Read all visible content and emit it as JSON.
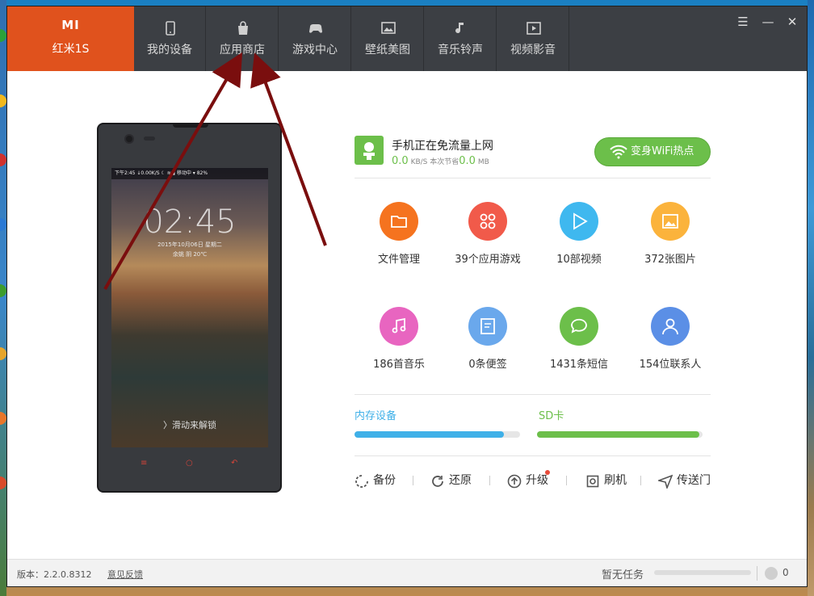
{
  "app": {
    "brand": "MI",
    "model": "红米1S"
  },
  "tabs": [
    {
      "label": "我的设备",
      "icon": "phone-icon"
    },
    {
      "label": "应用商店",
      "icon": "bag-icon"
    },
    {
      "label": "游戏中心",
      "icon": "gamepad-icon"
    },
    {
      "label": "壁纸美图",
      "icon": "picture-icon"
    },
    {
      "label": "音乐铃声",
      "icon": "music-note-icon"
    },
    {
      "label": "视频影音",
      "icon": "video-play-icon"
    }
  ],
  "window_controls": {
    "menu": "☰",
    "minimize": "—",
    "close": "✕"
  },
  "phone_screen": {
    "status_text": "下午2:45 ↓0.00K/S  ☾  ≋ ▮ 移动中 ▾ 82%",
    "clock": "02:45",
    "date": "2015年10月06日 星期二",
    "weather": "余姚 阴 20℃",
    "unlock_hint": "〉滑动来解锁",
    "softkeys": [
      "≡",
      "○",
      "↶"
    ]
  },
  "network": {
    "title": "手机正在免流量上网",
    "speed_value": "0.0",
    "speed_unit": "KB/S",
    "saved_label": "本次节省",
    "saved_value": "0.0",
    "saved_unit": "MB",
    "wifi_button": "变身WiFi热点"
  },
  "grid": [
    {
      "label": "文件管理",
      "icon": "folder-icon",
      "color": "#f5731f"
    },
    {
      "label": "39个应用游戏",
      "icon": "apps-grid-icon",
      "color": "#f15a4a"
    },
    {
      "label": "10部视频",
      "icon": "play-icon",
      "color": "#3fb8ef"
    },
    {
      "label": "372张图片",
      "icon": "image-icon",
      "color": "#fbb33c"
    },
    {
      "label": "186首音乐",
      "icon": "music-icon",
      "color": "#e865c0"
    },
    {
      "label": "0条便签",
      "icon": "note-icon",
      "color": "#6aa8ec"
    },
    {
      "label": "1431条短信",
      "icon": "chat-bubble-icon",
      "color": "#6cbf4a"
    },
    {
      "label": "154位联系人",
      "icon": "contact-icon",
      "color": "#5b8fe6"
    }
  ],
  "storage": [
    {
      "label": "内存设备",
      "used_fraction": 0.9,
      "color": "#3fb0e8"
    },
    {
      "label": "SD卡",
      "used_fraction": 0.98,
      "color": "#6cbf4a"
    }
  ],
  "actions": [
    {
      "label": "备份",
      "icon": "backup-icon"
    },
    {
      "label": "还原",
      "icon": "restore-icon"
    },
    {
      "label": "升级",
      "icon": "upgrade-icon",
      "badge": true
    },
    {
      "label": "刷机",
      "icon": "flash-icon"
    },
    {
      "label": "传送门",
      "icon": "send-icon"
    }
  ],
  "statusbar": {
    "version": "版本：2.2.0.8312",
    "feedback": "意见反馈",
    "task": "暂无任务",
    "download_count": "0"
  }
}
